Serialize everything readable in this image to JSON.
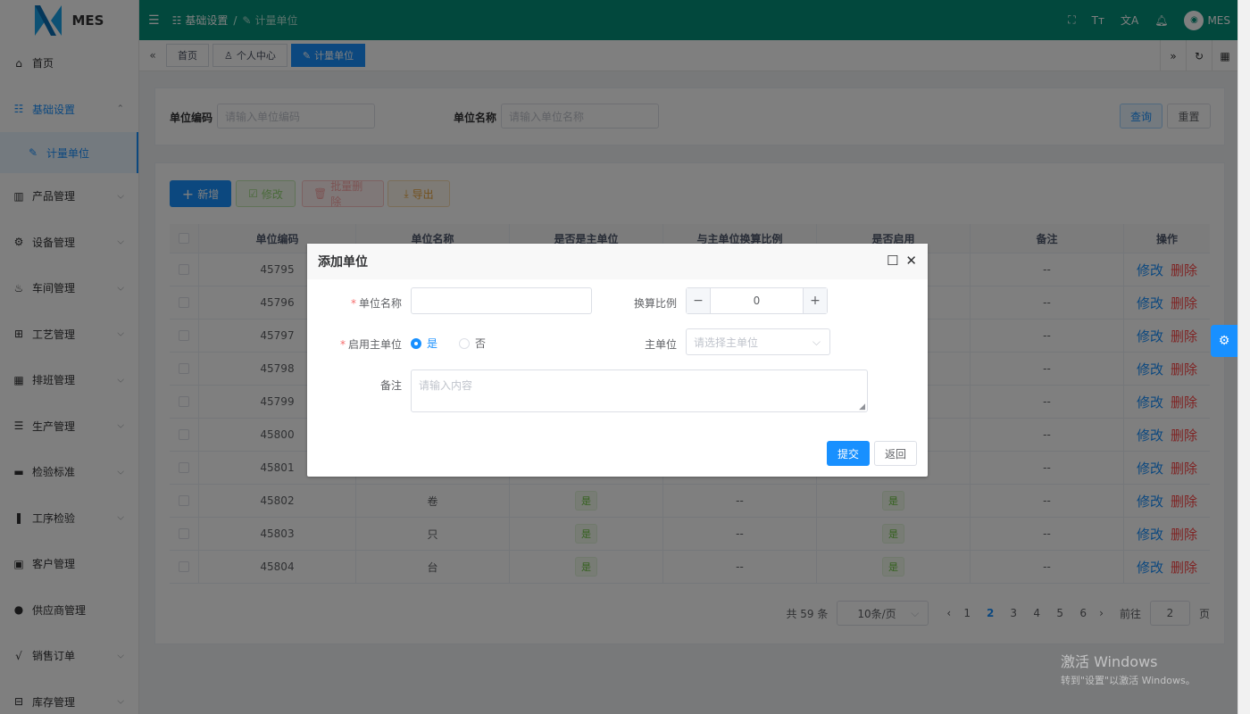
{
  "app": {
    "logo_text": "MES"
  },
  "sidebar": {
    "items": [
      {
        "label": "首页",
        "icon": "home-icon",
        "glyph": "⌂",
        "chevron": false
      },
      {
        "label": "基础设置",
        "icon": "settings-box-icon",
        "glyph": "☷",
        "chevron": true,
        "open": true
      },
      {
        "label": "计量单位",
        "icon": "pen-icon",
        "glyph": "✎",
        "sub": true
      },
      {
        "label": "产品管理",
        "icon": "bar-chart-icon",
        "glyph": "▥",
        "chevron": true
      },
      {
        "label": "设备管理",
        "icon": "gear-icon",
        "glyph": "⚙",
        "chevron": true
      },
      {
        "label": "车间管理",
        "icon": "factory-icon",
        "glyph": "♨",
        "chevron": true
      },
      {
        "label": "工艺管理",
        "icon": "process-icon",
        "glyph": "⊞",
        "chevron": true
      },
      {
        "label": "排班管理",
        "icon": "calendar-icon",
        "glyph": "▦",
        "chevron": true
      },
      {
        "label": "生产管理",
        "icon": "database-icon",
        "glyph": "☰",
        "chevron": true
      },
      {
        "label": "检验标准",
        "icon": "monitor-icon",
        "glyph": "▬",
        "chevron": true
      },
      {
        "label": "工序检验",
        "icon": "book-icon",
        "glyph": "❚",
        "chevron": true
      },
      {
        "label": "客户管理",
        "icon": "contact-icon",
        "glyph": "▣",
        "chevron": false
      },
      {
        "label": "供应商管理",
        "icon": "user-icon",
        "glyph": "●",
        "chevron": false
      },
      {
        "label": "销售订单",
        "icon": "order-icon",
        "glyph": "√",
        "chevron": true
      },
      {
        "label": "库存管理",
        "icon": "warehouse-icon",
        "glyph": "⊟",
        "chevron": true
      }
    ]
  },
  "header": {
    "breadcrumb": [
      "基础设置",
      "计量单位"
    ],
    "username": "MES",
    "icons": [
      "fullscreen-icon",
      "font-size-icon",
      "translate-icon",
      "bell-icon"
    ]
  },
  "tags": {
    "items": [
      "首页",
      "个人中心",
      "计量单位"
    ],
    "active": 2
  },
  "search": {
    "code_label": "单位编码",
    "code_placeholder": "请输入单位编码",
    "name_label": "单位名称",
    "name_placeholder": "请输入单位名称",
    "query_btn": "查询",
    "reset_btn": "重置"
  },
  "toolbar": {
    "add": "新增",
    "edit": "修改",
    "batch_delete": "批量删除",
    "export": "导出"
  },
  "table": {
    "headers": [
      "单位编码",
      "单位名称",
      "是否是主单位",
      "与主单位换算比例",
      "是否启用",
      "备注",
      "操作"
    ],
    "rows": [
      {
        "code": "45795",
        "name": "",
        "main": "",
        "ratio": "",
        "enabled": "",
        "remark": "--"
      },
      {
        "code": "45796",
        "name": "",
        "main": "",
        "ratio": "",
        "enabled": "",
        "remark": "--"
      },
      {
        "code": "45797",
        "name": "",
        "main": "",
        "ratio": "",
        "enabled": "",
        "remark": "--"
      },
      {
        "code": "45798",
        "name": "",
        "main": "",
        "ratio": "",
        "enabled": "",
        "remark": "--"
      },
      {
        "code": "45799",
        "name": "",
        "main": "",
        "ratio": "",
        "enabled": "",
        "remark": "--"
      },
      {
        "code": "45800",
        "name": "",
        "main": "",
        "ratio": "",
        "enabled": "",
        "remark": "--"
      },
      {
        "code": "45801",
        "name": "",
        "main": "",
        "ratio": "",
        "enabled": "",
        "remark": "--"
      },
      {
        "code": "45802",
        "name": "卷",
        "main": "是",
        "ratio": "--",
        "enabled": "是",
        "remark": "--"
      },
      {
        "code": "45803",
        "name": "只",
        "main": "是",
        "ratio": "--",
        "enabled": "是",
        "remark": "--"
      },
      {
        "code": "45804",
        "name": "台",
        "main": "是",
        "ratio": "--",
        "enabled": "是",
        "remark": "--"
      }
    ],
    "op_edit": "修改",
    "op_delete": "删除"
  },
  "pagination": {
    "total_text": "共 59 条",
    "page_size": "10条/页",
    "pages": [
      "1",
      "2",
      "3",
      "4",
      "5",
      "6"
    ],
    "current": "2",
    "goto_label": "前往",
    "goto_value": "2",
    "page_suffix": "页"
  },
  "dialog": {
    "title": "添加单位",
    "name_label": "单位名称",
    "ratio_label": "换算比例",
    "ratio_value": "0",
    "enable_main_label": "启用主单位",
    "yes": "是",
    "no": "否",
    "main_unit_label": "主单位",
    "main_unit_placeholder": "请选择主单位",
    "remark_label": "备注",
    "remark_placeholder": "请输入内容",
    "submit": "提交",
    "back": "返回"
  },
  "watermark": {
    "title": "激活 Windows",
    "subtitle": "转到\"设置\"以激活 Windows。"
  },
  "colors": {
    "header": "#05907a",
    "primary": "#1890ff",
    "danger": "#ff4949",
    "success": "#67c23a"
  }
}
